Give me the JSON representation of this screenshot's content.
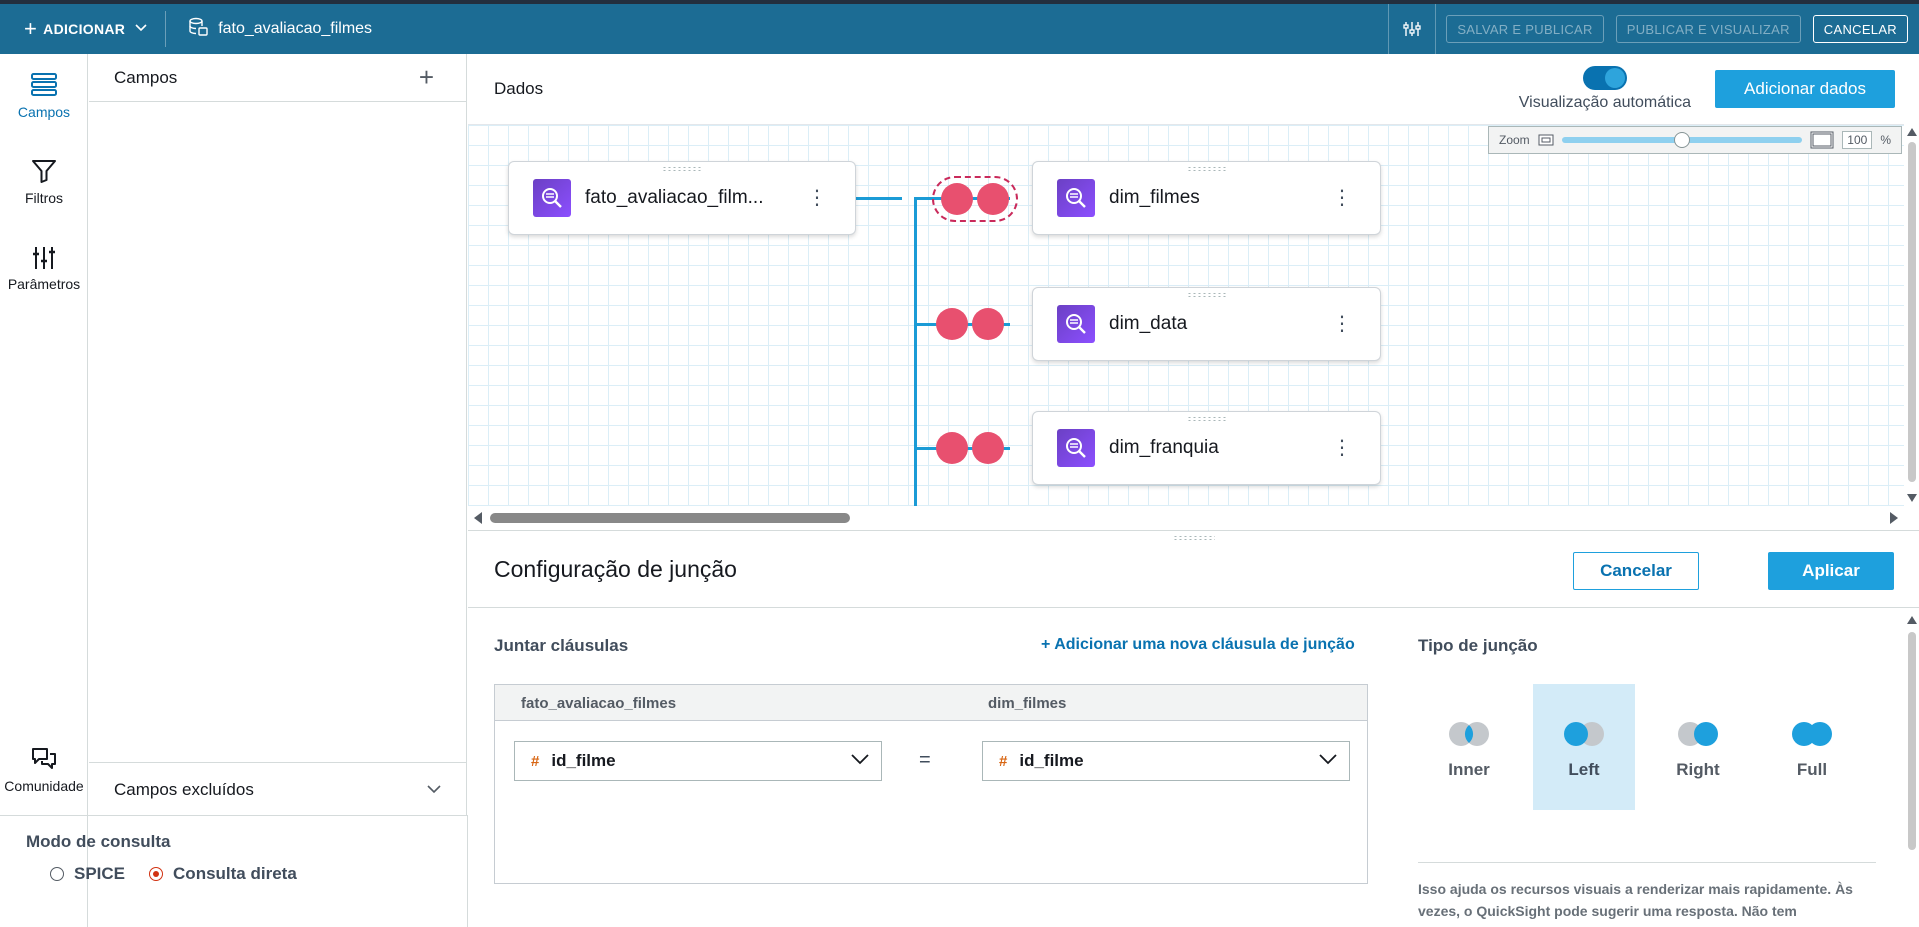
{
  "topbar": {
    "add_label": "ADICIONAR",
    "dataset_name": "fato_avaliacao_filmes",
    "save_publish": "SALVAR E PUBLICAR",
    "publish_view": "PUBLICAR E VISUALIZAR",
    "cancel": "CANCELAR"
  },
  "rail": {
    "fields": "Campos",
    "filters": "Filtros",
    "params": "Parâmetros",
    "community": "Comunidade"
  },
  "fields_panel": {
    "title": "Campos",
    "excluded": "Campos excluídos"
  },
  "query_mode": {
    "title": "Modo de consulta",
    "spice": "SPICE",
    "direct": "Consulta direta",
    "selected": "Consulta direta"
  },
  "data_header": {
    "title": "Dados",
    "auto_viz": "Visualização automática",
    "add_data": "Adicionar dados"
  },
  "zoom": {
    "label": "Zoom",
    "value": "100",
    "unit": "%",
    "slider_fraction": 0.5
  },
  "nodes": {
    "fact": "fato_avaliacao_film...",
    "dim1": "dim_filmes",
    "dim2": "dim_data",
    "dim3": "dim_franquia"
  },
  "join_config": {
    "title": "Configuração de junção",
    "cancel": "Cancelar",
    "apply": "Aplicar",
    "clauses_title": "Juntar cláusulas",
    "add_clause": "+ Adicionar uma nova cláusula de junção",
    "left_table": "fato_avaliacao_filmes",
    "right_table": "dim_filmes",
    "left_field": "id_filme",
    "right_field": "id_filme",
    "equals": "="
  },
  "join_type": {
    "title": "Tipo de junção",
    "inner": "Inner",
    "left": "Left",
    "right": "Right",
    "full": "Full",
    "selected": "Left",
    "help": "Isso ajuda os recursos visuais a renderizar mais rapidamente. Às vezes, o QuickSight pode sugerir uma resposta. Não tem"
  },
  "colors": {
    "topbar": "#1c6c94",
    "accent": "#1ea0dd",
    "join_circle": "#e8506f",
    "link_line": "#1b9bd6"
  }
}
